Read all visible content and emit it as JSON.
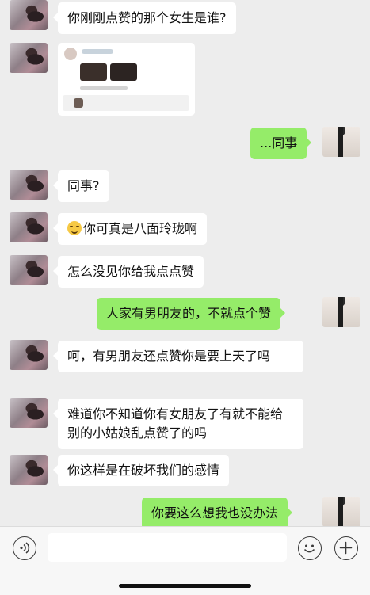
{
  "messages": [
    {
      "side": "left",
      "text": "你刚刚点赞的那个女生是谁?"
    },
    {
      "side": "left",
      "type": "image"
    },
    {
      "side": "right",
      "text": "...同事"
    },
    {
      "side": "left",
      "text": "同事?"
    },
    {
      "side": "left",
      "text": "你可真是八面玲珑啊",
      "emoji": "smile-emoji"
    },
    {
      "side": "left",
      "text": "怎么没见你给我点点赞"
    },
    {
      "side": "right",
      "text": "人家有男朋友的，不就点个赞"
    },
    {
      "side": "left",
      "text": "呵，有男朋友还点赞你是要上天了吗"
    },
    {
      "side": "left",
      "text": "难道你不知道你有女朋友了有就不能给别的小姑娘乱点赞了的吗"
    },
    {
      "side": "left",
      "text": "你这样是在破坏我们的感情"
    },
    {
      "side": "right",
      "text": "你要这么想我也没办法"
    }
  ],
  "toolbar": {
    "voice_icon": "voice-icon",
    "emoji_icon": "emoji-icon",
    "plus_icon": "plus-icon"
  },
  "colors": {
    "background": "#ededed",
    "own_bubble": "#95ec69",
    "other_bubble": "#ffffff"
  }
}
